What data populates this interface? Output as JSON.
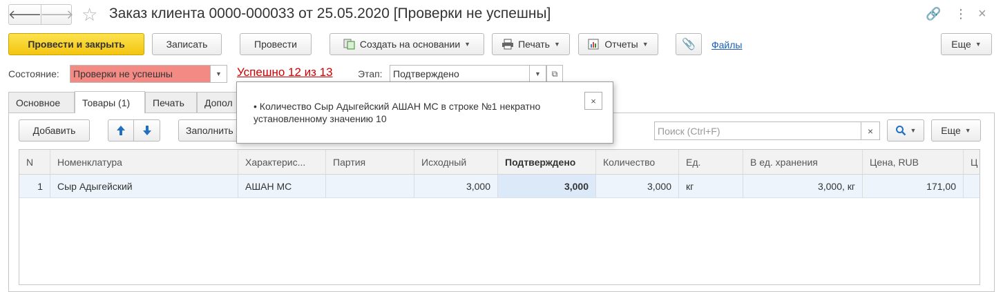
{
  "window": {
    "title": "Заказ клиента 0000-000033 от 25.05.2020 [Проверки не успешны]",
    "back_glyph": "🡐",
    "forward_glyph": "🡒",
    "star_glyph": "☆",
    "link_glyph": "🔗",
    "more_glyph": "⋮",
    "close_glyph": "×"
  },
  "toolbar": {
    "post_close": "Провести и закрыть",
    "save": "Записать",
    "post": "Провести",
    "create_based": "Создать на основании",
    "print": "Печать",
    "reports": "Отчеты",
    "files": "Файлы",
    "more": "Еще"
  },
  "state": {
    "label": "Состояние:",
    "value": "Проверки не успешны",
    "success_text": "Успешно 12 из 13",
    "stage_label": "Этап:",
    "stage_value": "Подтверждено"
  },
  "tabs": [
    {
      "label": "Основное"
    },
    {
      "label": "Товары (1)"
    },
    {
      "label": "Печать"
    },
    {
      "label": "Допол"
    }
  ],
  "goods_toolbar": {
    "add": "Добавить",
    "fill": "Заполнить",
    "search_placeholder": "Поиск (Ctrl+F)",
    "more": "Еще"
  },
  "table": {
    "columns": [
      "N",
      "Номенклатура",
      "Характерис...",
      "Партия",
      "Исходный",
      "Подтверждено",
      "Количество",
      "Ед.",
      "В ед. хранения",
      "Цена, RUB",
      "Ц"
    ],
    "rows": [
      [
        "1",
        "Сыр Адыгейский",
        "АШАН МС",
        "",
        "3,000",
        "3,000",
        "3,000",
        "кг",
        "3,000, кг",
        "171,00",
        ""
      ]
    ]
  },
  "popup": {
    "message": "• Количество Сыр Адыгейский АШАН МС в строке №1 некратно установленному значению 10",
    "close": "×"
  },
  "colors": {
    "primary_button": "#f4c510",
    "state_error": "#f48a84",
    "success_link": "#d00000",
    "files_link": "#1a5fb4",
    "arrow_blue": "#1f6fc5"
  }
}
